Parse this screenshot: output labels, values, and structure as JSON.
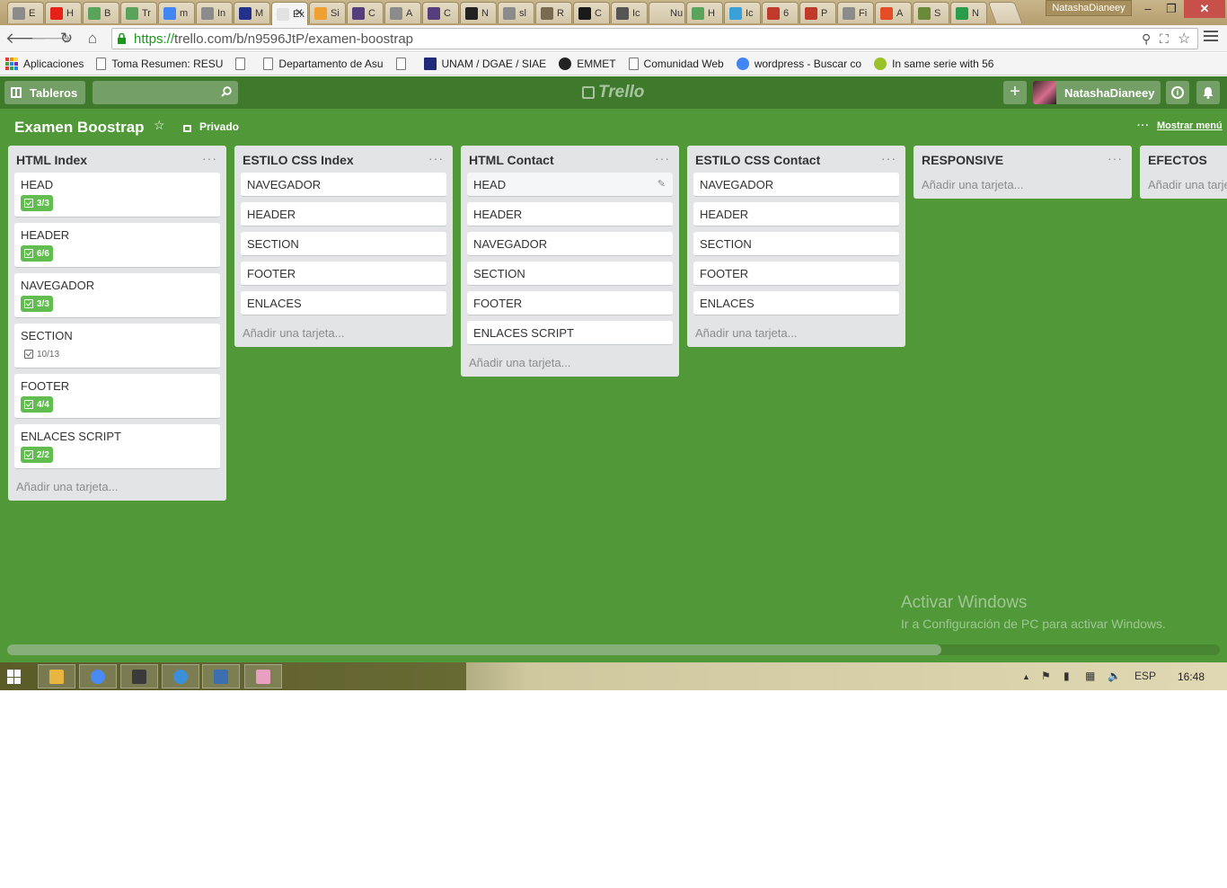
{
  "browser": {
    "tabs": [
      {
        "title": "E",
        "icon": "doc-icon",
        "color": "#8b8b8b"
      },
      {
        "title": "H",
        "icon": "youtube-icon",
        "color": "#e62117"
      },
      {
        "title": "B",
        "icon": "w3-icon",
        "color": "#5aa35a"
      },
      {
        "title": "Tr",
        "icon": "w3-icon",
        "color": "#5aa35a"
      },
      {
        "title": "m",
        "icon": "google-icon",
        "color": "#4285f4"
      },
      {
        "title": "In",
        "icon": "doc-icon",
        "color": "#8b8b8b"
      },
      {
        "title": "M",
        "icon": "hcc-icon",
        "color": "#23318a"
      },
      {
        "title": "Ex",
        "icon": "trello-icon",
        "color": "#e2e2e2",
        "active": true
      },
      {
        "title": "Si",
        "icon": "orange-icon",
        "color": "#f0a030"
      },
      {
        "title": "C",
        "icon": "bootstrap-icon",
        "color": "#563d7c"
      },
      {
        "title": "A",
        "icon": "doc-icon",
        "color": "#8b8b8b"
      },
      {
        "title": "C",
        "icon": "bootstrap-icon",
        "color": "#563d7c"
      },
      {
        "title": "N",
        "icon": "github-icon",
        "color": "#222222"
      },
      {
        "title": "sl",
        "icon": "doc-icon",
        "color": "#8b8b8b"
      },
      {
        "title": "R",
        "icon": "person-icon",
        "color": "#7a6a50"
      },
      {
        "title": "C",
        "icon": "fm-icon",
        "color": "#1a1a1a"
      },
      {
        "title": "Ic",
        "icon": "circle-icon",
        "color": "#555555"
      },
      {
        "title": "Nuev",
        "icon": "none",
        "color": "#00000000"
      },
      {
        "title": "H",
        "icon": "w3-icon",
        "color": "#5aa35a"
      },
      {
        "title": "Ic",
        "icon": "filter-icon",
        "color": "#3aa0d8"
      },
      {
        "title": "6",
        "icon": "book-icon",
        "color": "#c0392b"
      },
      {
        "title": "P",
        "icon": "book-icon",
        "color": "#c0392b"
      },
      {
        "title": "Fi",
        "icon": "doc-icon",
        "color": "#8b8b8b"
      },
      {
        "title": "A",
        "icon": "html5-icon",
        "color": "#e44d26"
      },
      {
        "title": "S",
        "icon": "sync-icon",
        "color": "#6a8a3a"
      },
      {
        "title": "N",
        "icon": "drive-icon",
        "color": "#2a9d4a"
      }
    ],
    "profile_name": "NatashaDianeey",
    "window_controls": {
      "minimize": "–",
      "restore": "❐",
      "close": "✕"
    },
    "url_protocol": "https://",
    "url_rest": "trello.com/b/n9596JtP/examen-boostrap",
    "bookmarks": [
      {
        "label": "Aplicaciones",
        "icon": "apps-icon"
      },
      {
        "label": "Toma Resumen: RESU",
        "icon": "page-icon"
      },
      {
        "label": "",
        "icon": "page-icon"
      },
      {
        "label": "Departamento de Asu",
        "icon": "page-icon"
      },
      {
        "label": "",
        "icon": "page-icon"
      },
      {
        "label": "UNAM / DGAE / SIAE",
        "icon": "unam-icon"
      },
      {
        "label": "EMMET",
        "icon": "emmet-icon"
      },
      {
        "label": "Comunidad Web",
        "icon": "page-icon"
      },
      {
        "label": "wordpress - Buscar co",
        "icon": "google-icon"
      },
      {
        "label": "In same serie with 56",
        "icon": "circle-icon"
      }
    ]
  },
  "header": {
    "boards_label": "Tableros",
    "logo_text": "Trello",
    "add_label": "+",
    "username": "NatashaDianeey",
    "info_label": "i"
  },
  "board": {
    "title": "Examen Boostrap",
    "privacy": "Privado",
    "show_menu": "Mostrar menú",
    "background": "#519839",
    "add_card_label": "Añadir una tarjeta..."
  },
  "lists": [
    {
      "name": "HTML Index",
      "cards": [
        {
          "title": "HEAD",
          "checklist": "3/3",
          "complete": true
        },
        {
          "title": "HEADER",
          "checklist": "6/6",
          "complete": true
        },
        {
          "title": "NAVEGADOR",
          "checklist": "3/3",
          "complete": true
        },
        {
          "title": "SECTION",
          "checklist": "10/13",
          "complete": false
        },
        {
          "title": "FOOTER",
          "checklist": "4/4",
          "complete": true
        },
        {
          "title": "ENLACES SCRIPT",
          "checklist": "2/2",
          "complete": true
        }
      ]
    },
    {
      "name": "ESTILO CSS Index",
      "cards": [
        {
          "title": "NAVEGADOR"
        },
        {
          "title": "HEADER"
        },
        {
          "title": "SECTION"
        },
        {
          "title": "FOOTER"
        },
        {
          "title": "ENLACES"
        }
      ]
    },
    {
      "name": "HTML Contact",
      "cards": [
        {
          "title": "HEAD",
          "hover": true
        },
        {
          "title": "HEADER"
        },
        {
          "title": "NAVEGADOR"
        },
        {
          "title": "SECTION"
        },
        {
          "title": "FOOTER"
        },
        {
          "title": "ENLACES SCRIPT"
        }
      ]
    },
    {
      "name": "ESTILO CSS Contact",
      "cards": [
        {
          "title": "NAVEGADOR"
        },
        {
          "title": "HEADER"
        },
        {
          "title": "SECTION"
        },
        {
          "title": "FOOTER"
        },
        {
          "title": "ENLACES"
        }
      ]
    },
    {
      "name": "RESPONSIVE",
      "cards": []
    },
    {
      "name": "EFECTOS",
      "cards": []
    }
  ],
  "watermark": {
    "title": "Activar Windows",
    "subtitle": "Ir a Configuración de PC para activar Windows."
  },
  "taskbar": {
    "apps": [
      {
        "name": "file-explorer-icon",
        "color": "#e8b640"
      },
      {
        "name": "chrome-icon",
        "color": "#4a8af4"
      },
      {
        "name": "app-icon",
        "color": "#3a3a3a"
      },
      {
        "name": "ie-icon",
        "color": "#3b8fd8"
      },
      {
        "name": "remote-desktop-icon",
        "color": "#3b6fb0"
      },
      {
        "name": "paint-icon",
        "color": "#e9a0c0"
      }
    ],
    "language": "ESP",
    "time": "16:48"
  }
}
